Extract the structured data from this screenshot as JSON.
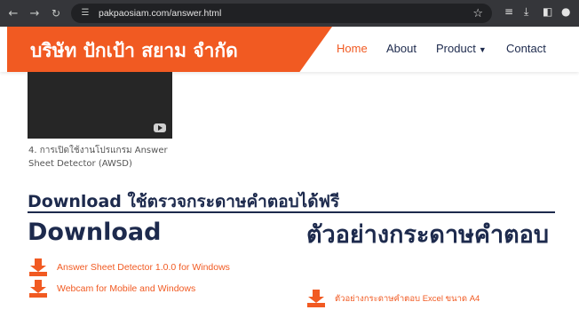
{
  "browser": {
    "url": "pakpaosiam.com/answer.html"
  },
  "header": {
    "brand": "บริษัท ปักเป้า สยาม จำกัด",
    "nav": [
      {
        "label": "Home",
        "active": true
      },
      {
        "label": "About"
      },
      {
        "label": "Product"
      },
      {
        "label": "Contact"
      }
    ]
  },
  "video": {
    "caption": "4. การเปิดใช้งานโปรแกรม Answer Sheet Detector (AWSD)"
  },
  "section": {
    "title": "Download ใช้ตรวจกระดาษคำตอบได้ฟรี"
  },
  "download_col": {
    "title": "Download",
    "links": [
      "Answer Sheet Detector 1.0.0 for Windows",
      "Webcam for Mobile and Windows"
    ]
  },
  "sample_col": {
    "title": "ตัวอย่างกระดาษคำตอบ",
    "links": [
      "ตัวอย่างกระดาษคำตอบ Excel ขนาด A4"
    ]
  },
  "colors": {
    "brand_orange": "#f15a22",
    "navy": "#1d2a4d"
  }
}
